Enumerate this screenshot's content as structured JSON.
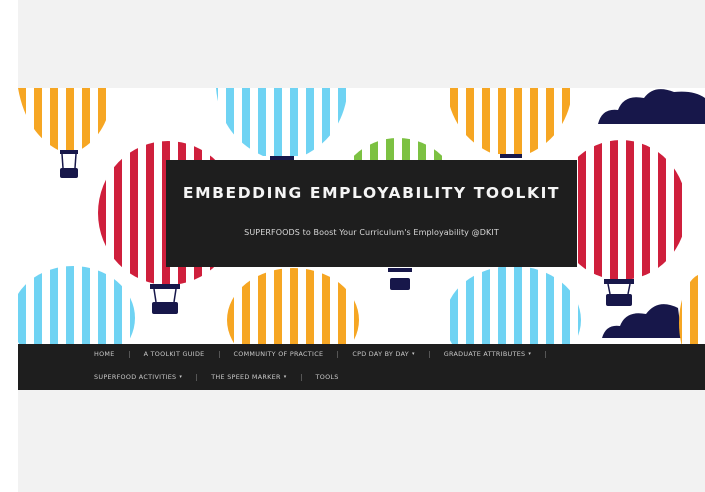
{
  "site": {
    "title": "EMBEDDING EMPLOYABILITY TOOLKIT",
    "description": "SUPERFOODS to Boost Your Curriculum's Employability @DKIT"
  },
  "nav": {
    "row1": [
      {
        "label": "HOME",
        "has_dropdown": false
      },
      {
        "label": "A TOOLKIT GUIDE",
        "has_dropdown": false
      },
      {
        "label": "COMMUNITY OF PRACTICE",
        "has_dropdown": false
      },
      {
        "label": "CPD DAY BY DAY",
        "has_dropdown": true
      },
      {
        "label": "GRADUATE ATTRIBUTES",
        "has_dropdown": true
      }
    ],
    "row2": [
      {
        "label": "SUPERFOOD ACTIVITIES",
        "has_dropdown": true
      },
      {
        "label": "THE SPEED MARKER",
        "has_dropdown": true
      },
      {
        "label": "TOOLS",
        "has_dropdown": false
      }
    ],
    "dropdown_glyph": "▾"
  },
  "colors": {
    "balloon_yellow": "#f6a623",
    "balloon_blue": "#6fd3f3",
    "balloon_red": "#cf1f3c",
    "balloon_green": "#7cc142",
    "cloud_navy": "#17174a",
    "title_box": "#1e1e1e",
    "navbar": "#1e1e1e"
  }
}
